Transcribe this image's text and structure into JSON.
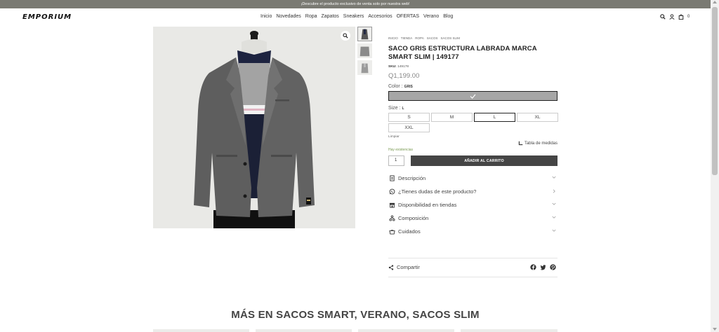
{
  "promo": {
    "text": "¡Descubre el producto exclusivo de venta solo por nuestra web!"
  },
  "header": {
    "logo": "EMPORIUM",
    "nav": [
      "Inicio",
      "Novedades",
      "Ropa",
      "Zapatos",
      "Sneakers",
      "Accesorios",
      "OFERTAS",
      "Verano",
      "Blog"
    ],
    "icons": [
      "search-icon",
      "user-icon",
      "cart-icon"
    ],
    "cart_count": "0"
  },
  "gallery": {
    "thumbnails": 3,
    "zoom_icon": "zoom-icon"
  },
  "product": {
    "breadcrumb": [
      "INICIO",
      "TIENDA",
      "ROPA",
      "SACOS",
      "SACOS SLIM"
    ],
    "title": "SACO GRIS ESTRUCTURA LABRADA MARCA SMART SLIM | 149177",
    "sku_label": "SKU:",
    "sku": "149178",
    "price": "Q1,199.00",
    "color_label": "Color",
    "color_value": "GRIS",
    "color_hex": "#a6a6a6",
    "size_label": "Size",
    "size_value": "L",
    "sizes": [
      "S",
      "M",
      "L",
      "XL",
      "XXL"
    ],
    "selected_size": "L",
    "clear_label": "Limpiar",
    "size_table_label": "Tabla de medidas",
    "stock_text": "Hay existencias",
    "stock_color": "#7a9a53",
    "quantity": "1",
    "add_to_cart": "AÑADIR AL CARRITO",
    "accordion": [
      {
        "label": "Descripción",
        "icon": "description-icon",
        "chevron": "down"
      },
      {
        "label": "¿Tienes dudas de este producto?",
        "icon": "whatsapp-icon",
        "chevron": "right"
      },
      {
        "label": "Disponibilidad en tiendas",
        "icon": "store-icon",
        "chevron": "down"
      },
      {
        "label": "Composición",
        "icon": "composition-icon",
        "chevron": "down"
      },
      {
        "label": "Cuidados",
        "icon": "care-icon",
        "chevron": "down"
      }
    ],
    "share_label": "Compartir",
    "share_icons": [
      "facebook-icon",
      "twitter-icon",
      "pinterest-icon"
    ]
  },
  "related": {
    "title": "MÁS EN SACOS SMART, VERANO, SACOS SLIM"
  }
}
